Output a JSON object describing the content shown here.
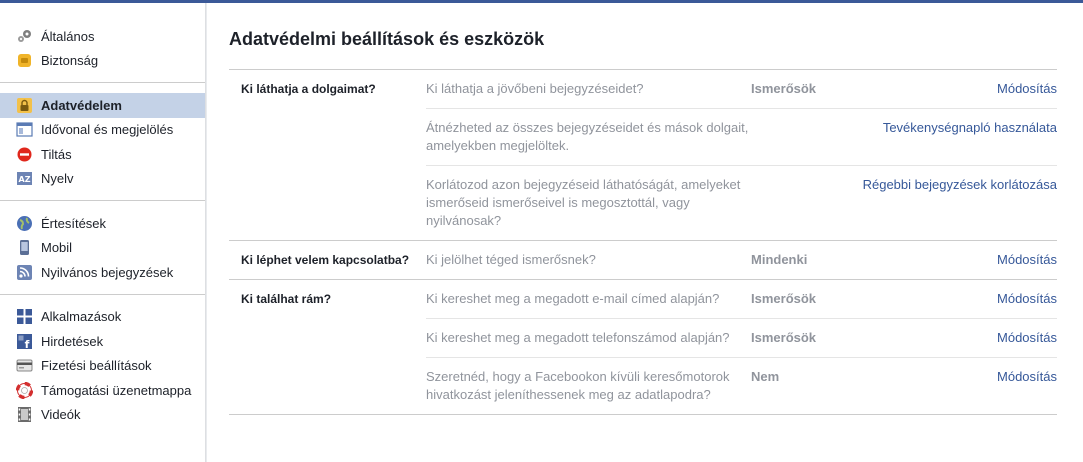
{
  "sidebar": {
    "groups": [
      [
        {
          "label": "Általános",
          "icon": "gears-icon"
        },
        {
          "label": "Biztonság",
          "icon": "badge-icon"
        }
      ],
      [
        {
          "label": "Adatvédelem",
          "icon": "lock-icon"
        },
        {
          "label": "Idővonal és megjelölés",
          "icon": "timeline-icon"
        },
        {
          "label": "Tiltás",
          "icon": "block-icon"
        },
        {
          "label": "Nyelv",
          "icon": "language-icon"
        }
      ],
      [
        {
          "label": "Értesítések",
          "icon": "globe-icon"
        },
        {
          "label": "Mobil",
          "icon": "mobile-icon"
        },
        {
          "label": "Nyilvános bejegyzések",
          "icon": "rss-icon"
        }
      ],
      [
        {
          "label": "Alkalmazások",
          "icon": "apps-icon"
        },
        {
          "label": "Hirdetések",
          "icon": "ads-icon"
        },
        {
          "label": "Fizetési beállítások",
          "icon": "card-icon"
        },
        {
          "label": "Támogatási üzenetmappa",
          "icon": "lifebuoy-icon"
        },
        {
          "label": "Videók",
          "icon": "film-icon"
        }
      ]
    ]
  },
  "main": {
    "title": "Adatvédelmi beállítások és eszközök",
    "sections": [
      {
        "heading": "Ki láthatja a dolgaimat?",
        "rows": [
          {
            "question": "Ki láthatja a jövőbeni bejegyzéseidet?",
            "value": "Ismerősök",
            "action": "Módosítás"
          },
          {
            "question": "Átnézheted az összes bejegyzéseidet és mások dolgait, amelyekben megjelöltek.",
            "value": "",
            "action": "Tevékenységnapló használata"
          },
          {
            "question": "Korlátozod azon bejegyzéseid láthatóságát, amelyeket ismerőseid ismerőseivel is megosztottál, vagy nyilvánosak?",
            "value": "",
            "action": "Régebbi bejegyzések korlátozása"
          }
        ]
      },
      {
        "heading": "Ki léphet velem kapcsolatba?",
        "rows": [
          {
            "question": "Ki jelölhet téged ismerősnek?",
            "value": "Mindenki",
            "action": "Módosítás"
          }
        ]
      },
      {
        "heading": "Ki találhat rám?",
        "rows": [
          {
            "question": "Ki kereshet meg a megadott e-mail címed alapján?",
            "value": "Ismerősök",
            "action": "Módosítás"
          },
          {
            "question": "Ki kereshet meg a megadott telefonszámod alapján?",
            "value": "Ismerősök",
            "action": "Módosítás"
          },
          {
            "question": "Szeretnéd, hogy a Facebookon kívüli keresőmotorok hivatkozást jeleníthessenek meg az adatlapodra?",
            "value": "Nem",
            "action": "Módosítás"
          }
        ]
      }
    ]
  },
  "active_item": "Adatvédelem",
  "colors": {
    "accent": "#3b5998",
    "link": "#365899",
    "active_bg": "#c4d2e7"
  }
}
